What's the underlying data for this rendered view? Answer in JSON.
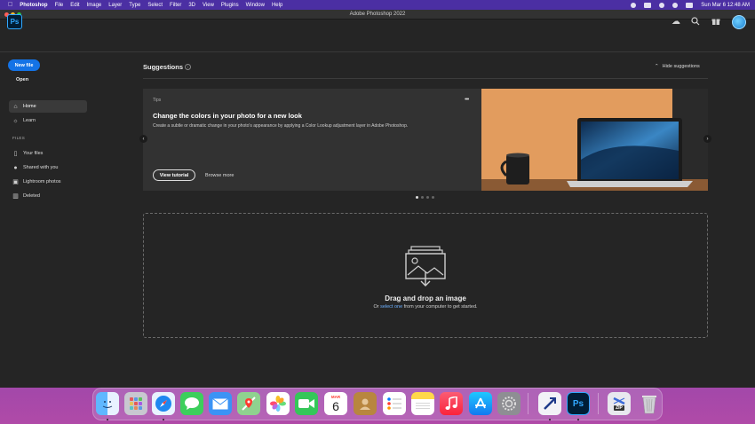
{
  "menubar": {
    "apple": "",
    "items": [
      "Photoshop",
      "File",
      "Edit",
      "Image",
      "Layer",
      "Type",
      "Select",
      "Filter",
      "3D",
      "View",
      "Plugins",
      "Window",
      "Help"
    ],
    "datetime": "Sun Mar 6  12:48 AM"
  },
  "window": {
    "title": "Adobe Photoshop 2022"
  },
  "appbar": {
    "logo": "Ps",
    "icons": [
      "cloud-icon",
      "search-icon",
      "gift-icon",
      "avatar"
    ]
  },
  "sidebar": {
    "new_file": "New file",
    "open": "Open",
    "nav": [
      {
        "label": "Home",
        "icon": "home-icon",
        "active": true
      },
      {
        "label": "Learn",
        "icon": "bulb-icon",
        "active": false
      }
    ],
    "files_label": "FILES",
    "files": [
      {
        "label": "Your files",
        "icon": "file-icon"
      },
      {
        "label": "Shared with you",
        "icon": "people-icon"
      },
      {
        "label": "Lightroom photos",
        "icon": "lightroom-icon"
      },
      {
        "label": "Deleted",
        "icon": "trash-icon"
      }
    ]
  },
  "suggestions": {
    "title": "Suggestions",
    "hide": "Hide suggestions",
    "card": {
      "tag": "Tips",
      "title": "Change the colors in your photo for a new look",
      "description": "Create a subtle or dramatic change in your photo's appearance by applying a Color Lookup adjustment layer in Adobe Photoshop.",
      "primary": "View tutorial",
      "secondary": "Browse more",
      "more": "•••"
    },
    "dots_total": 4,
    "dots_active": 1
  },
  "dropzone": {
    "title": "Drag and drop an image",
    "prefix": "Or ",
    "link": "select one",
    "suffix": " from your computer to get started."
  },
  "dock": {
    "calendar_month": "MAR",
    "calendar_day": "6",
    "zip_label": "ZIP",
    "ps_label": "Ps"
  },
  "colors": {
    "accent": "#1473e6",
    "ps_blue": "#31a8ff",
    "background": "#252525"
  }
}
